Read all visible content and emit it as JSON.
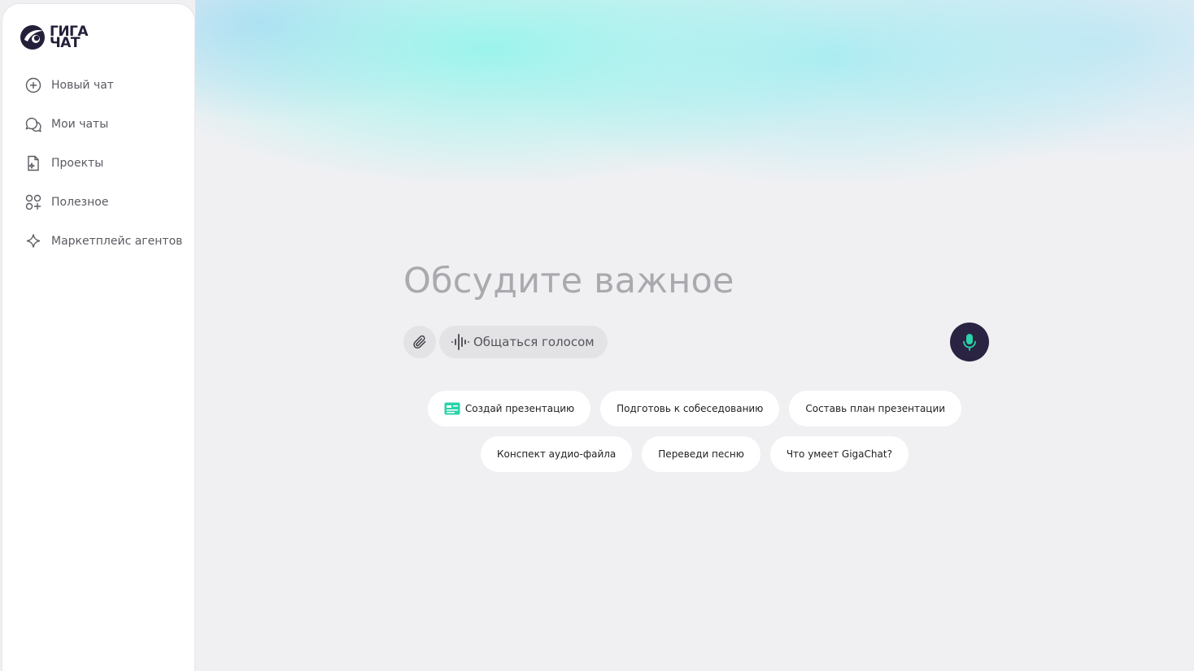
{
  "logo": {
    "line1": "ГИГА",
    "line2": "ЧАТ"
  },
  "nav": [
    {
      "label": "Новый чат",
      "icon": "plus-circle-icon"
    },
    {
      "label": "Мои чаты",
      "icon": "chat-bubbles-icon"
    },
    {
      "label": "Проекты",
      "icon": "project-file-icon"
    },
    {
      "label": "Полезное",
      "icon": "grid-plus-icon"
    },
    {
      "label": "Маркетплейс агентов",
      "icon": "sparkle-icon"
    }
  ],
  "composer": {
    "placeholder": "Обсудите важное",
    "voice_label": "Общаться голосом"
  },
  "suggestions": {
    "row1": [
      "Создай презентацию",
      "Подготовь к собеседованию",
      "Составь план презентации"
    ],
    "row2": [
      "Конспект аудио-файла",
      "Переведи песню",
      "Что умеет GigaChat?"
    ]
  },
  "colors": {
    "accent": "#2ad3a8",
    "mic_button": "#2b2342",
    "sidebar_bg": "#ffffff",
    "page_bg": "#f0f0f3"
  }
}
